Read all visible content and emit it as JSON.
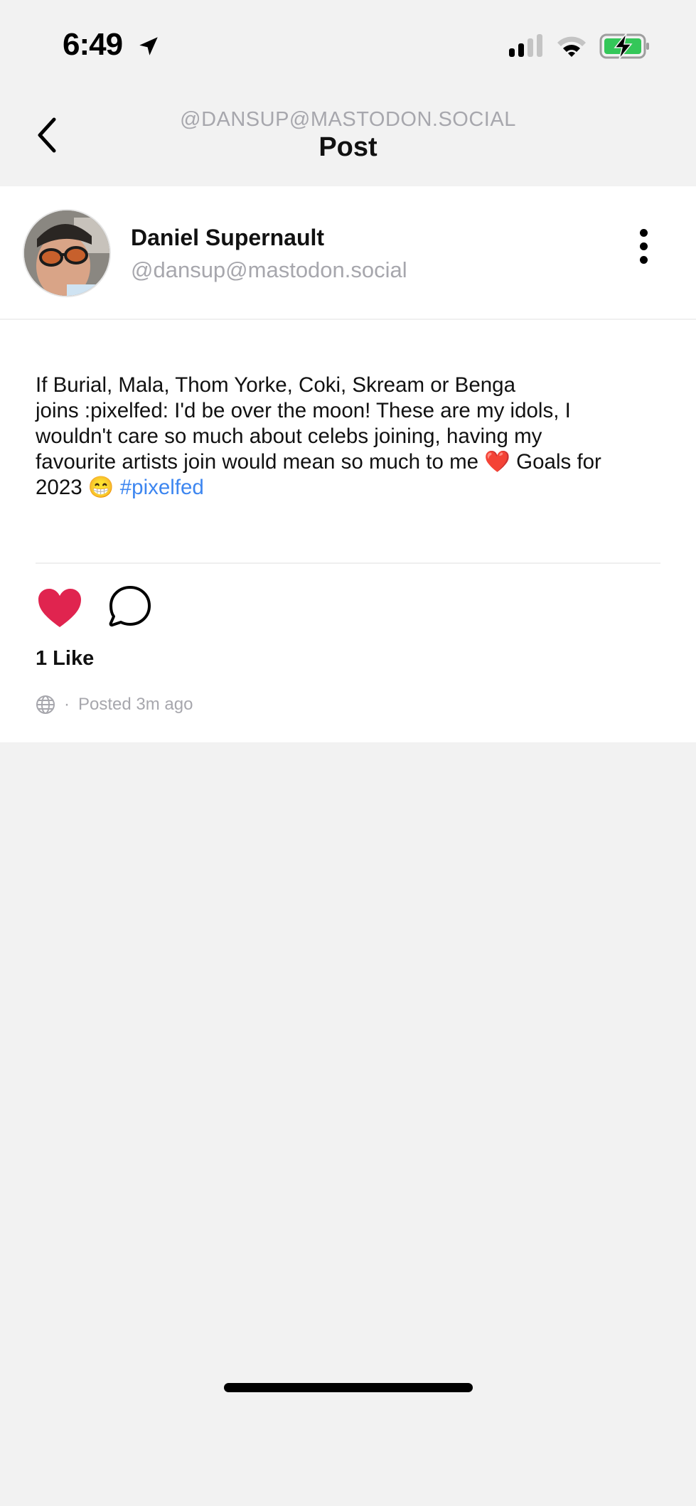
{
  "status_bar": {
    "time": "6:49",
    "icons": [
      "location-arrow-icon",
      "cellular-signal-icon",
      "wifi-icon",
      "battery-charging-icon"
    ],
    "battery_color": "#34c759"
  },
  "nav": {
    "subtitle": "@DANSUP@MASTODON.SOCIAL",
    "title": "Post",
    "back_icon": "chevron-left-icon"
  },
  "post": {
    "author": {
      "display_name": "Daniel Supernault",
      "handle": "@dansup@mastodon.social"
    },
    "more_icon": "vertical-ellipsis-icon",
    "content": {
      "line1": "If Burial, Mala, Thom Yorke, Coki, Skream or Benga",
      "line2": "joins :pixelfed: I'd be over the moon! These are my idols, I",
      "line3": "wouldn't care so much about celebs joining, having my",
      "line4": "favourite  artists join would mean so much to me ❤️ Goals for",
      "line5": "2023 😁 ",
      "hashtag": "#pixelfed"
    },
    "actions": {
      "like_icon": "heart-filled-icon",
      "comment_icon": "comment-bubble-icon",
      "like_color": "#e0244f"
    },
    "likes_label": "1 Like",
    "visibility_icon": "globe-icon",
    "separator": "·",
    "posted_label": "Posted 3m ago"
  },
  "colors": {
    "hashtag": "#3d86f0",
    "muted": "#a7a7ad",
    "background": "#f2f2f2"
  }
}
